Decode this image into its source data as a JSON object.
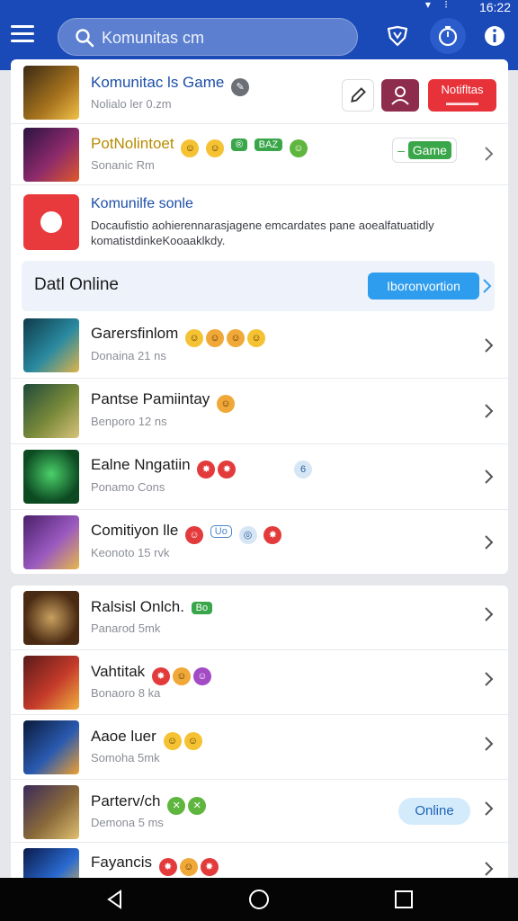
{
  "status_bar": {
    "time": "16:22"
  },
  "search": {
    "placeholder": "Komunitas",
    "value": "Komunitas cm"
  },
  "top_rows": [
    {
      "title": "Komunitac ls Game",
      "sub": "Nolialo ler 0.zm",
      "action_label": "Notifltas"
    },
    {
      "title": "PotNolintoet",
      "sub": "Sonanic Rm",
      "badges": [
        "®",
        "BAZ"
      ],
      "action_label": "Game"
    }
  ],
  "info": {
    "title": "Komunilfe sonle",
    "desc": "Docaufistio aohierennarasjagene emcardates pane aoealfatuatidly komatistdinkeKooaaklkdy."
  },
  "section": {
    "heading": "Datl Online",
    "button": "Iboronvortion"
  },
  "list_one": [
    {
      "title": "Garersfinlom",
      "sub": "Donaina 21 ns"
    },
    {
      "title": "Pantse Pamiintay",
      "sub": "Benporo 12 ns"
    },
    {
      "title": "Ealne Nngatiin",
      "sub": "Ponamo Cons"
    },
    {
      "title": "Comitiyon lle",
      "sub": "Keonoto 15 rvk",
      "badges": [
        "Uo"
      ]
    }
  ],
  "list_two": [
    {
      "title": "Ralsisl Onlch.",
      "sub": "Panarod 5mk",
      "badges": [
        "Bo"
      ]
    },
    {
      "title": "Vahtitak",
      "sub": "Bonaoro 8 ka"
    },
    {
      "title": "Aaoe luer",
      "sub": "Somoha 5mk"
    },
    {
      "title": "Parterv/ch",
      "sub": "Demona 5 ms",
      "action_label": "Online"
    },
    {
      "title": "Fayancis",
      "sub": ""
    }
  ],
  "colors": {
    "topbar": "#1a49b8",
    "accent_blue": "#2f9ded",
    "danger": "#e8323a"
  }
}
